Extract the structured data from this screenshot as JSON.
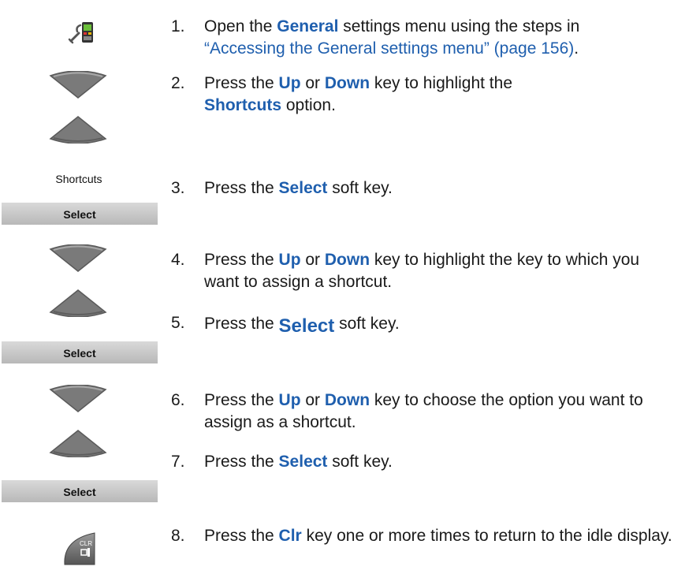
{
  "steps": [
    {
      "n": "1.",
      "parts": [
        "Open the ",
        "General",
        " settings menu using the steps in ",
        "“Accessing the General settings menu” (page 156)",
        "."
      ]
    },
    {
      "n": "2.",
      "parts": [
        "Press the ",
        "Up",
        " or ",
        "Down",
        " key to highlight the ",
        "Shortcuts",
        " option."
      ]
    },
    {
      "n": "3.",
      "parts": [
        "Press the ",
        "Select",
        " soft key."
      ]
    },
    {
      "n": "4.",
      "parts": [
        "Press the ",
        "Up",
        " or ",
        "Down",
        " key to highlight the key to which you want to assign a shortcut."
      ]
    },
    {
      "n": "5.",
      "parts": [
        "Press the ",
        "Select",
        " soft key."
      ]
    },
    {
      "n": "6.",
      "parts": [
        "Press the ",
        "Up",
        " or ",
        "Down",
        " key to choose the option you want to assign as a shortcut."
      ]
    },
    {
      "n": "7.",
      "parts": [
        "Press the ",
        "Select",
        " soft key."
      ]
    },
    {
      "n": "8.",
      "parts": [
        "Press the ",
        "Clr",
        " key one or more times to return to the idle display."
      ]
    }
  ],
  "icons": {
    "shortcuts_label": "Shortcuts",
    "softkey_label": "Select",
    "clr_key_label": "CLR"
  },
  "colors": {
    "keyword": "#1f5fae",
    "softkey_bg": "#c8c8c8",
    "nav_key": "#7a7a7a"
  }
}
